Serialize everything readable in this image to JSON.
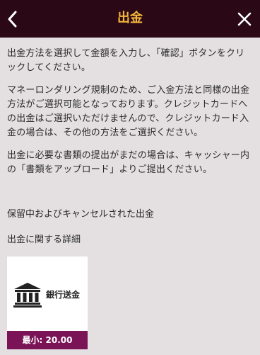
{
  "header": {
    "title": "出金"
  },
  "instructions": {
    "para1": "出金方法を選択して金額を入力し、「確認」ボタンをクリックしてください。",
    "para2": "マネーロンダリング規制のため、ご入金方法と同様の出金方法がご選択可能となっております。クレジットカードへの出金はご選択いただけませんので、クレジットカード入金の場合は、その他の方法をご選択ください。",
    "para3": "出金に必要な書類の提出がまだの場合は、キャッシャー内の「書類をアップロード」よりご提出ください。"
  },
  "links": {
    "pending": "保留中およびキャンセルされた出金",
    "details": "出金に関する詳細"
  },
  "methods": [
    {
      "label": "銀行送金",
      "icon": "bank-icon",
      "min_label": "最小: 20.00"
    }
  ],
  "colors": {
    "header_bg": "#2a0816",
    "title": "#f3b63c",
    "page_bg": "#e4e0e2",
    "min_bar": "#7a1457"
  }
}
